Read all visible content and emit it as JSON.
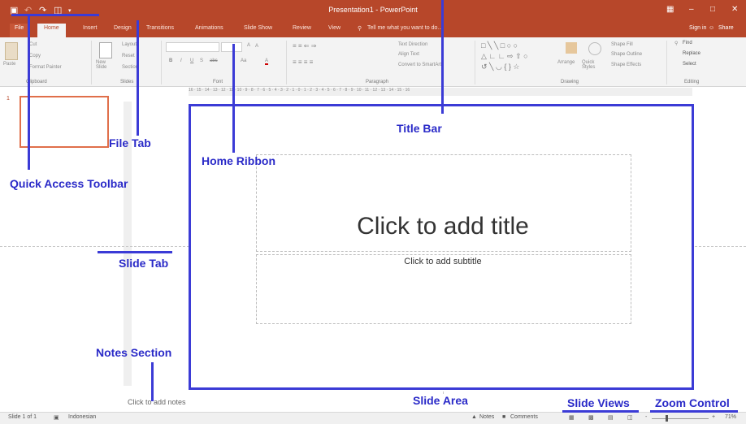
{
  "titlebar": {
    "title": "Presentation1 - PowerPoint",
    "save_icon": "save-icon",
    "undo_icon": "undo-icon",
    "redo_icon": "redo-icon",
    "present_icon": "present-icon",
    "customize_icon": "chevron-down-icon",
    "ribbon_options_icon": "ribbon-display-icon",
    "minimize": "–",
    "maximize": "□",
    "close": "✕"
  },
  "tabs": [
    "File",
    "Home",
    "Insert",
    "Design",
    "Transitions",
    "Animations",
    "Slide Show",
    "Review",
    "View"
  ],
  "tell_me": "Tell me what you want to do...",
  "account": {
    "sign_in": "Sign in",
    "share": "Share"
  },
  "ribbon": {
    "clipboard": {
      "paste": "Paste",
      "cut": "Cut",
      "copy": "Copy",
      "format_painter": "Format Painter",
      "label": "Clipboard"
    },
    "slides": {
      "new_slide": "New Slide",
      "layout": "Layout",
      "reset": "Reset",
      "section": "Section",
      "label": "Slides"
    },
    "font": {
      "bold": "B",
      "italic": "I",
      "underline": "U",
      "strike": "S",
      "spacing": "abc",
      "case": "Aa",
      "color": "A",
      "grow": "A",
      "shrink": "A",
      "label": "Font"
    },
    "paragraph": {
      "text_direction": "Text Direction",
      "align_text": "Align Text",
      "smartart": "Convert to SmartArt",
      "label": "Paragraph"
    },
    "drawing": {
      "arrange": "Arrange",
      "quick_styles": "Quick Styles",
      "shape_fill": "Shape Fill",
      "shape_outline": "Shape Outline",
      "shape_effects": "Shape Effects",
      "label": "Drawing"
    },
    "editing": {
      "find": "Find",
      "replace": "Replace",
      "select": "Select",
      "label": "Editing"
    }
  },
  "ruler_h": "16 · 15 · 14 · 13 · 12 · 11 · 10 · 9 · 8 · 7 · 6 · 5 · 4 · 3 · 2 · 1 · 0 · 1 · 2 · 3 · 4 · 5 · 6 · 7 · 8 · 9 · 10 · 11 · 12 · 13 · 14 · 15 · 16",
  "thumbnail_number": "1",
  "slide": {
    "title_placeholder": "Click to add title",
    "subtitle_placeholder": "Click to add subtitle"
  },
  "notes_placeholder": "Click to add notes",
  "statusbar": {
    "slide_count": "Slide 1 of 1",
    "language": "Indonesian",
    "notes": "Notes",
    "comments": "Comments",
    "zoom_minus": "-",
    "zoom_plus": "+",
    "zoom_level": "71%",
    "zoom_fraction": 0.71
  },
  "annotations": {
    "title_bar": "Title Bar",
    "file_tab": "File Tab",
    "home_ribbon": "Home Ribbon",
    "quick_access_toolbar": "Quick Access Toolbar",
    "slide_tab": "Slide Tab",
    "notes_section": "Notes Section",
    "slide_area": "Slide Area",
    "slide_views": "Slide Views",
    "zoom_control": "Zoom Control"
  },
  "colors": {
    "accent": "#b7472a",
    "annotation": "#3b3bd6",
    "thumb_border": "#e06f4a"
  }
}
